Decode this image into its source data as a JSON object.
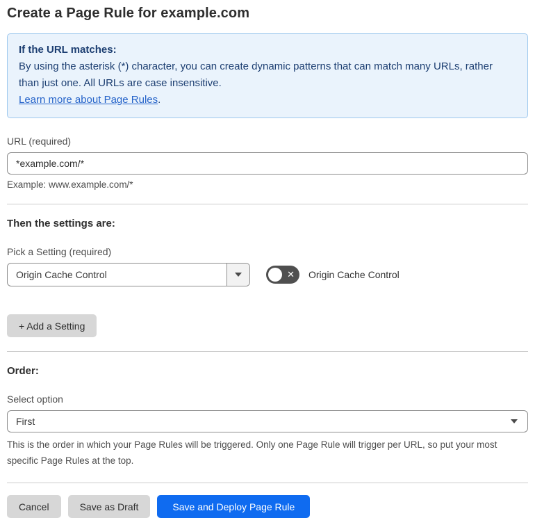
{
  "page": {
    "title": "Create a Page Rule for example.com"
  },
  "info_box": {
    "heading": "If the URL matches:",
    "body": "By using the asterisk (*) character, you can create dynamic patterns that can match many URLs, rather than just one. All URLs are case insensitive.",
    "link_label": "Learn more about Page Rules",
    "link_suffix": "."
  },
  "url_field": {
    "label": "URL (required)",
    "value": "*example.com/*",
    "helper": "Example: www.example.com/*"
  },
  "settings_section": {
    "heading": "Then the settings are:",
    "picker_label": "Pick a Setting (required)",
    "selected_setting": "Origin Cache Control",
    "toggle": {
      "label": "Origin Cache Control",
      "state": "off",
      "off_glyph": "✕"
    },
    "add_setting_label": "+ Add a Setting"
  },
  "order_section": {
    "heading": "Order:",
    "select_label": "Select option",
    "selected_option": "First",
    "helper": "This is the order in which your Page Rules will be triggered. Only one Page Rule will trigger per URL, so put your most specific Page Rules at the top."
  },
  "footer": {
    "cancel_label": "Cancel",
    "save_draft_label": "Save as Draft",
    "save_deploy_label": "Save and Deploy Page Rule"
  },
  "colors": {
    "accent_blue": "#0f6bf0",
    "info_bg": "#eaf3fc",
    "info_border": "#9ec8ee",
    "info_text": "#1d3f72",
    "link_blue": "#2563c9",
    "toggle_off_bg": "#4f4f4f"
  }
}
